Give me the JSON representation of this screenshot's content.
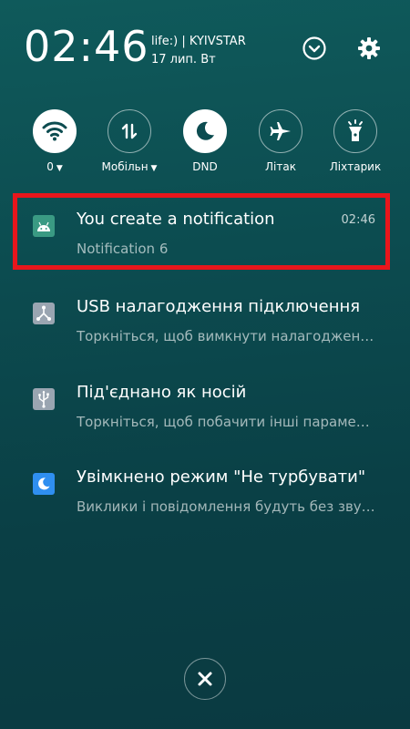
{
  "header": {
    "clock": "02:46",
    "carrier": "life:) | KYIVSTAR",
    "date": "17 лип. Вт",
    "icons": [
      "chevron-down-icon",
      "gear-icon"
    ]
  },
  "quick_toggles": [
    {
      "name": "wifi",
      "label": "0",
      "has_caret": true,
      "icon": "wifi-icon",
      "state": "on"
    },
    {
      "name": "mobile-data",
      "label": "Мобільн",
      "has_caret": true,
      "icon": "mobile-data-icon",
      "state": "off"
    },
    {
      "name": "dnd",
      "label": "DND",
      "has_caret": false,
      "icon": "moon-icon",
      "state": "on"
    },
    {
      "name": "airplane",
      "label": "Літак",
      "has_caret": false,
      "icon": "airplane-icon",
      "state": "off"
    },
    {
      "name": "flashlight",
      "label": "Ліхтарик",
      "has_caret": false,
      "icon": "flashlight-icon",
      "state": "off"
    }
  ],
  "notifications": [
    {
      "title": "You create a notification",
      "body": "Notification 6",
      "time": "02:46",
      "icon": "android-icon",
      "highlighted": true
    },
    {
      "title": "USB налагодження підключення",
      "body": "Торкніться, щоб вимкнути налагодження USB",
      "time": "",
      "icon": "usb-debug-icon"
    },
    {
      "title": "Під'єднано як носій",
      "body": "Торкніться, щоб побачити інші параметри",
      "time": "",
      "icon": "usb-icon"
    },
    {
      "title": "Увімкнено режим \"Не турбувати\"",
      "body": "Виклики і повідомлення будуть без звуку",
      "time": "",
      "icon": "moon-icon"
    }
  ],
  "footer": {
    "icon": "close-icon"
  },
  "colors": {
    "highlight": "#e8161c",
    "background": "#0c4c50"
  }
}
